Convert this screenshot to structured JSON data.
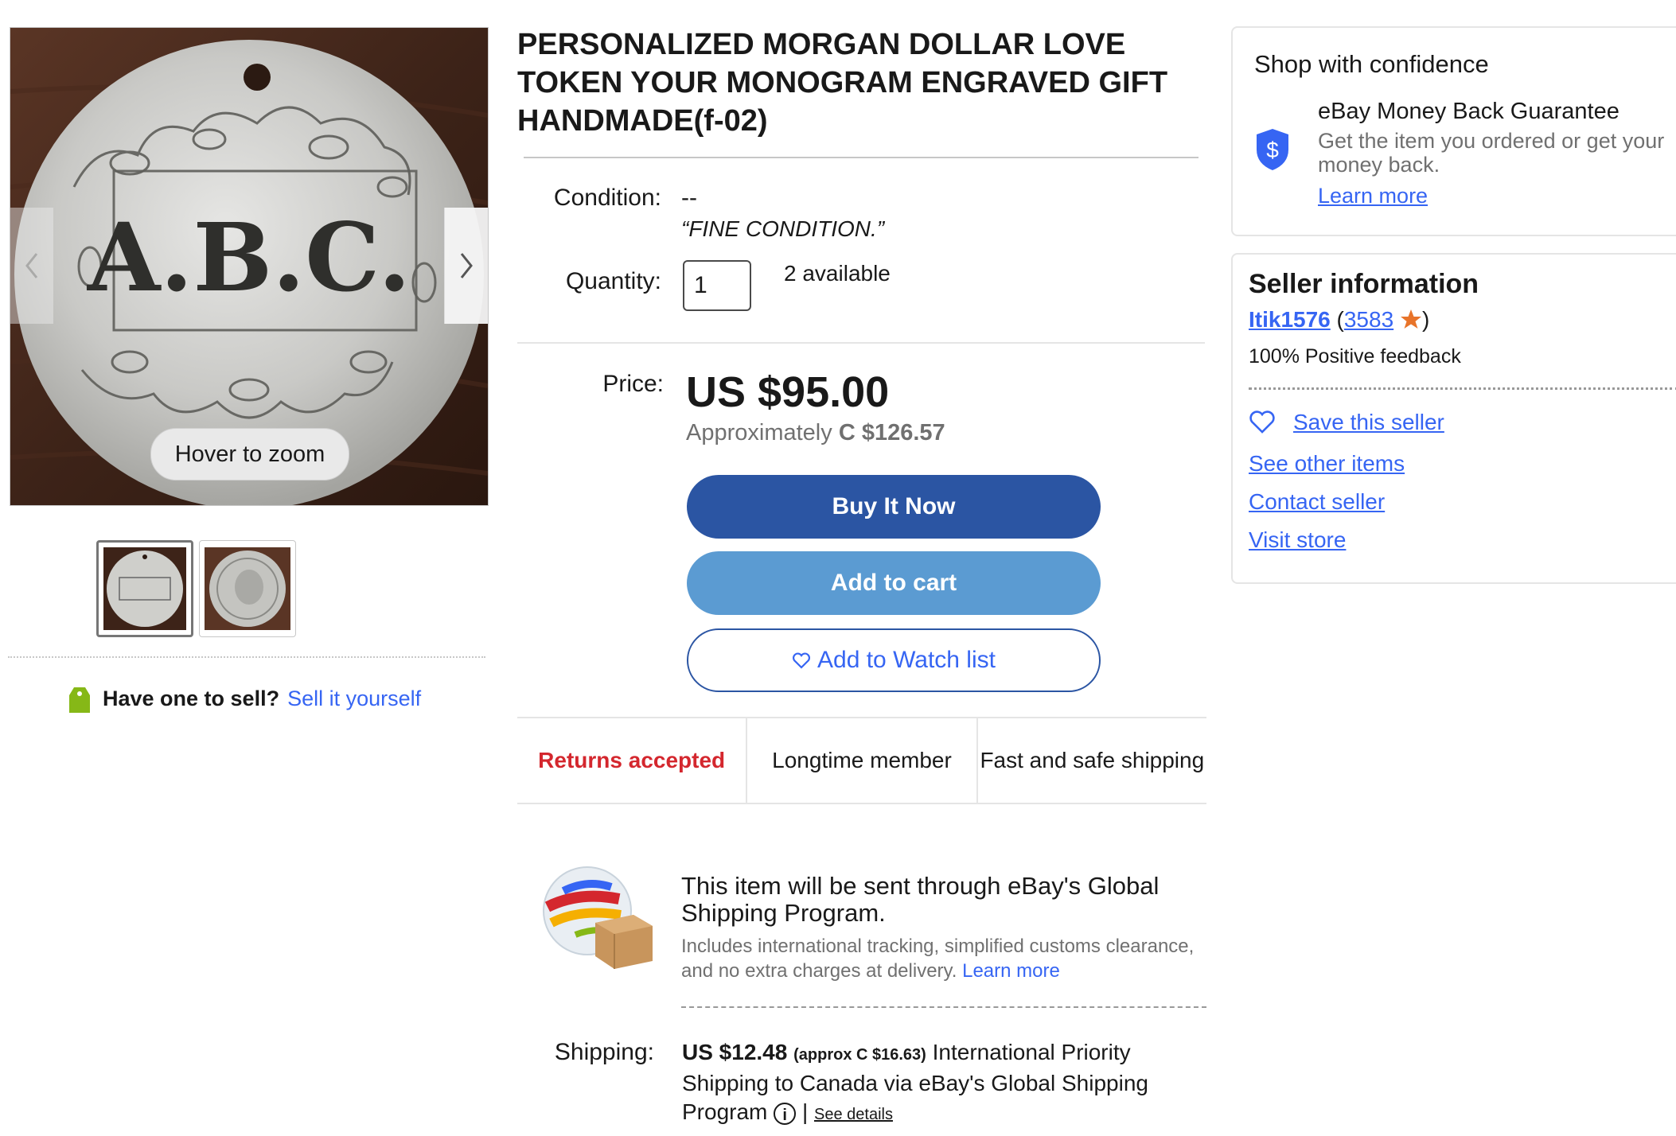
{
  "gallery": {
    "hover_label": "Hover to zoom",
    "engraving_text": "A.B.C."
  },
  "sell": {
    "question": "Have one to sell?",
    "link": "Sell it yourself"
  },
  "item": {
    "title": "PERSONALIZED MORGAN DOLLAR LOVE TOKEN YOUR MONOGRAM ENGRAVED GIFT HANDMADE(f-02)",
    "condition_label": "Condition:",
    "condition_value": "--",
    "condition_desc": "“FINE CONDITION.”",
    "quantity_label": "Quantity:",
    "quantity_value": "1",
    "available": "2 available",
    "price_label": "Price:",
    "price": "US $95.00",
    "approx_prefix": "Approximately",
    "approx_value": "C $126.57"
  },
  "actions": {
    "buy_now": "Buy It Now",
    "add_to_cart": "Add to cart",
    "watch_list": "Add to Watch list"
  },
  "badges": {
    "returns": "Returns accepted",
    "member": "Longtime member",
    "shipping": "Fast and safe shipping"
  },
  "gsp": {
    "title": "This item will be sent through eBay's Global Shipping Program.",
    "desc": "Includes international tracking, simplified customs clearance, and no extra charges at delivery.",
    "learn_more": "Learn more"
  },
  "shipping": {
    "label": "Shipping:",
    "amount": "US $12.48",
    "approx": "(approx C $16.63)",
    "desc": "International Priority Shipping to Canada via eBay's Global Shipping Program",
    "separator": "|",
    "details": "See details"
  },
  "confidence": {
    "title": "Shop with confidence",
    "guarantee_title": "eBay Money Back Guarantee",
    "guarantee_desc": "Get the item you ordered or get your money back.",
    "learn_more": "Learn more"
  },
  "seller": {
    "title": "Seller information",
    "name": "Itik1576",
    "open_paren": "(",
    "score": "3583",
    "close_paren": ")",
    "feedback": "100% Positive feedback",
    "save": "Save this seller",
    "other_items": "See other items",
    "contact": "Contact seller",
    "store": "Visit store"
  },
  "colors": {
    "buy_now": "#2b55a3",
    "add_to_cart": "#5b9bd2",
    "link": "#3665f3",
    "returns": "#d4272e",
    "star": "#e8742a"
  }
}
